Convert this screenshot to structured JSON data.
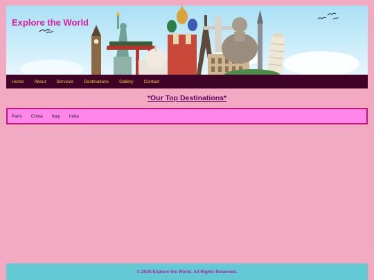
{
  "site": {
    "title": "Explore the World"
  },
  "nav": {
    "items": [
      {
        "label": "Home"
      },
      {
        "label": "About"
      },
      {
        "label": "Services"
      },
      {
        "label": "Destinations"
      },
      {
        "label": "Gallery"
      },
      {
        "label": "Contact"
      }
    ]
  },
  "main": {
    "heading": "*Our Top Destinations*",
    "destinations": [
      {
        "label": "Paris"
      },
      {
        "label": "China"
      },
      {
        "label": "Italy"
      },
      {
        "label": "India"
      }
    ]
  },
  "footer": {
    "text": "© 2025 Explore the World. All Rights Reserved."
  },
  "colors": {
    "page_bg": "#f2a9c2",
    "title": "#d81ca3",
    "nav_bg": "#3f0327",
    "nav_text": "#ffc83d",
    "heading": "#5e0b63",
    "dest_box_bg": "#ff86ea",
    "dest_box_border": "#c2187c",
    "footer_bg": "#62c9d5",
    "footer_text": "#b5179e"
  },
  "header_image": {
    "depicts": "world-landmarks-collage"
  }
}
